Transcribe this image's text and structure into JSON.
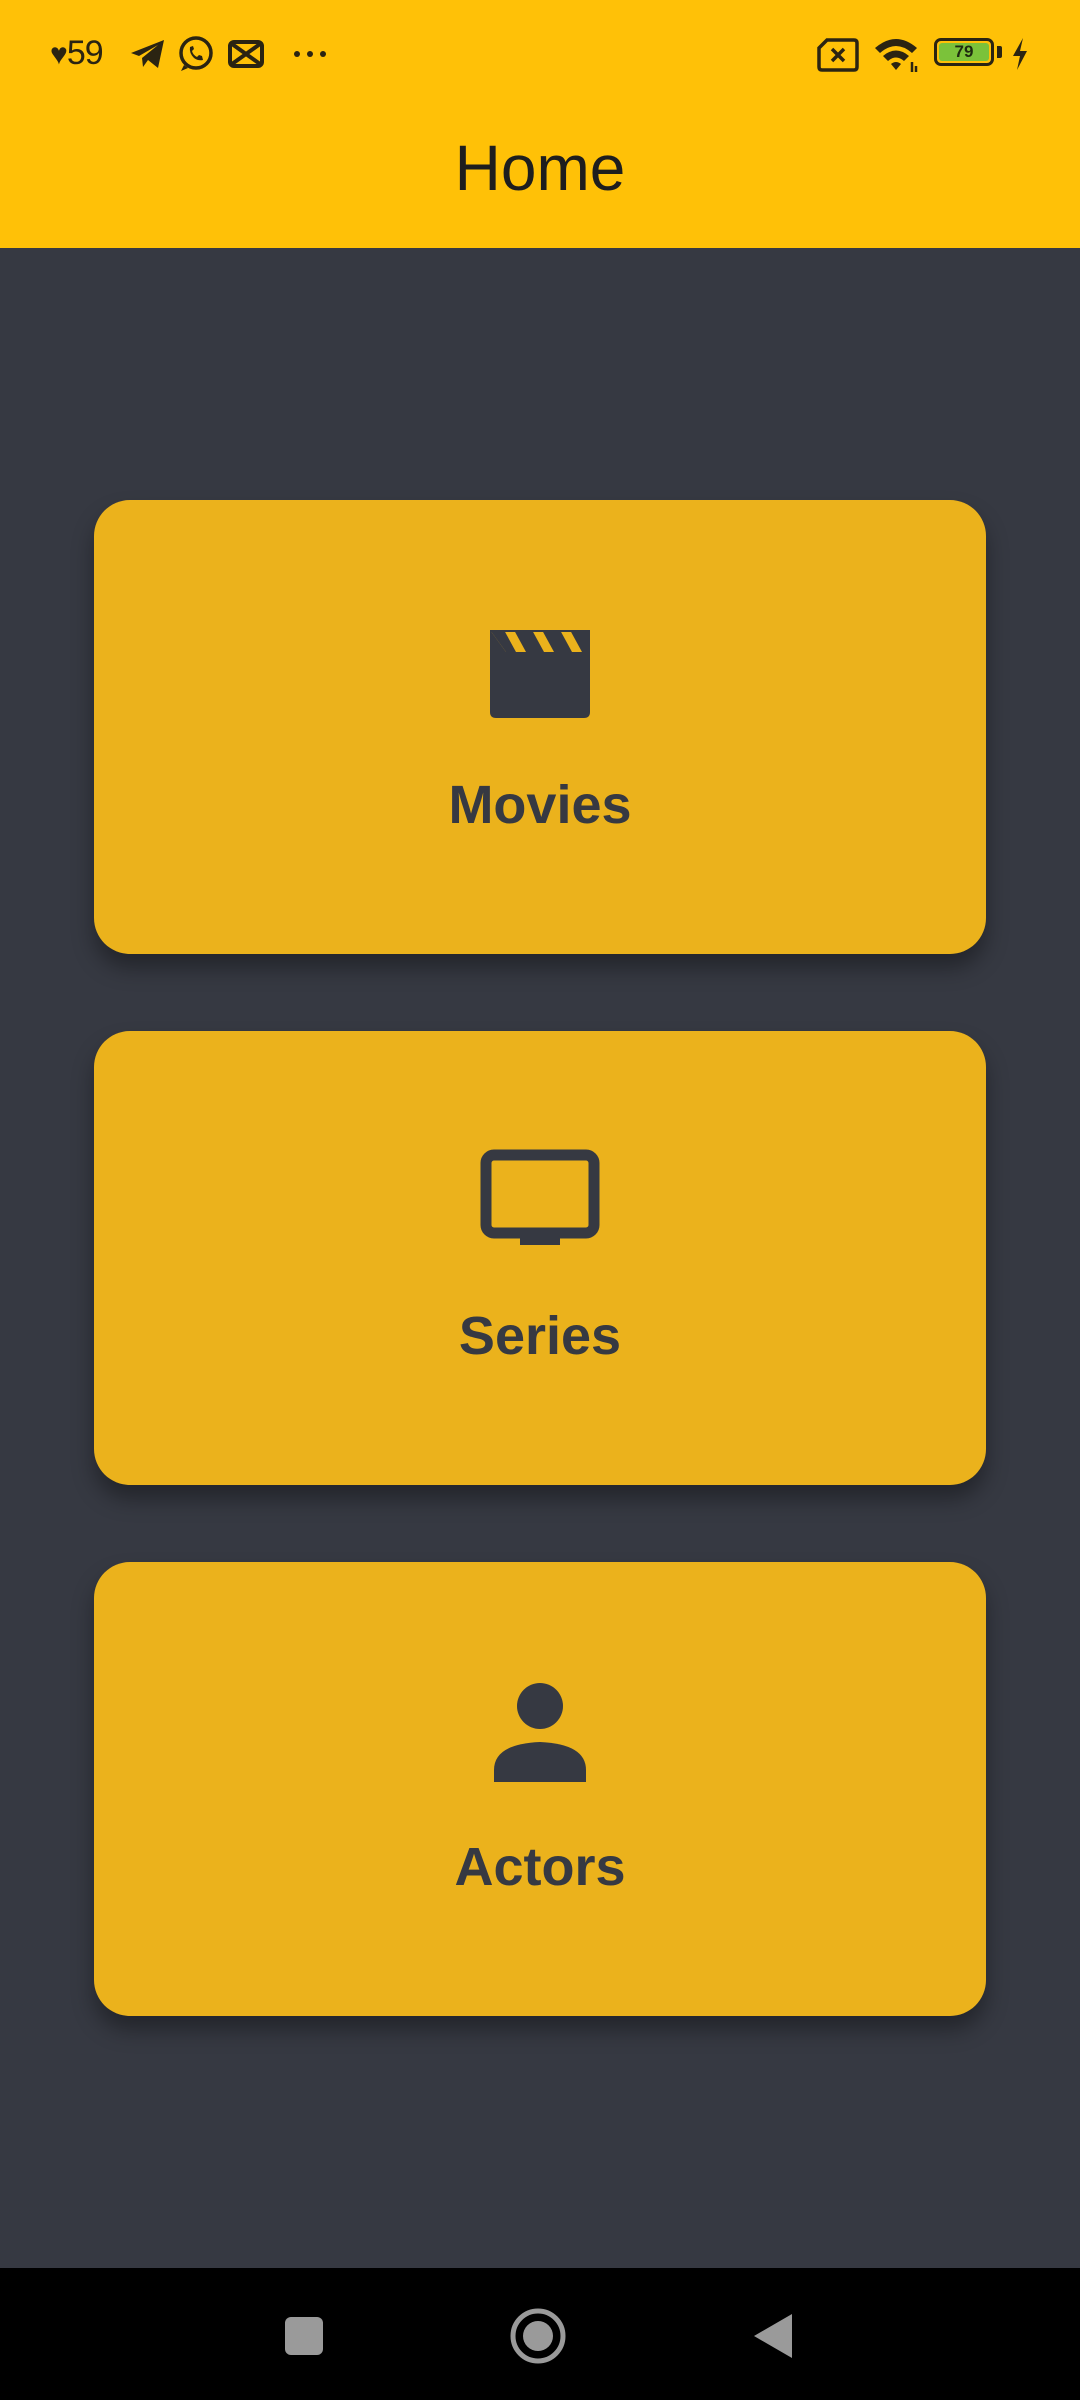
{
  "status_bar": {
    "time_prefix": "♥",
    "time": "59",
    "battery_level": "79",
    "icons": [
      "heart-icon",
      "telegram-icon",
      "whatsapp-icon",
      "capcut-icon",
      "more-dots-icon",
      "no-sim-icon",
      "wifi-icon",
      "battery-icon",
      "charging-bolt-icon"
    ]
  },
  "app_bar": {
    "title": "Home"
  },
  "menu": {
    "items": [
      {
        "label": "Movies",
        "icon": "movie-clapper-icon"
      },
      {
        "label": "Series",
        "icon": "tv-icon"
      },
      {
        "label": "Actors",
        "icon": "person-icon"
      }
    ]
  },
  "nav_bar": {
    "buttons": [
      "recents-square-button",
      "home-circle-button",
      "back-triangle-button"
    ]
  },
  "colors": {
    "app_bar": "#FFC107",
    "background": "#363942",
    "card": "#EBB21C",
    "card_content": "#363942",
    "battery_fill": "#7BC23A"
  }
}
